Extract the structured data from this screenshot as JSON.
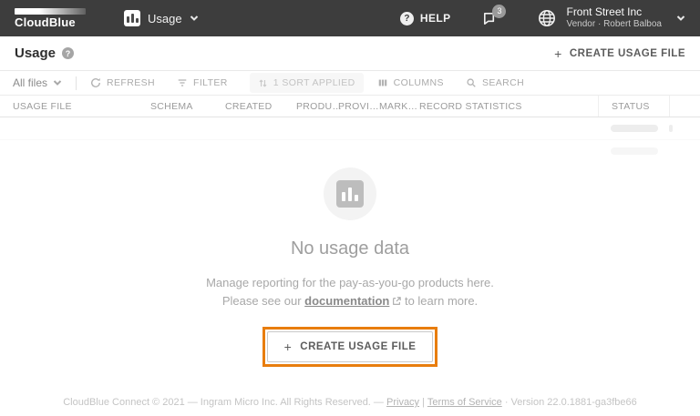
{
  "topbar": {
    "logo": "CloudBlue",
    "module_label": "Usage",
    "help_label": "HELP",
    "notification_count": "3",
    "account_name": "Front Street Inc",
    "account_role": "Vendor · Robert Balboa"
  },
  "page": {
    "title": "Usage",
    "help_glyph": "?",
    "create_label": "CREATE USAGE FILE",
    "plus_glyph": "+"
  },
  "toolbar": {
    "files_filter": "All files",
    "refresh": "REFRESH",
    "filter": "FILTER",
    "sort": "1 SORT APPLIED",
    "columns": "COLUMNS",
    "search": "SEARCH"
  },
  "table": {
    "columns": [
      "USAGE FILE",
      "SCHEMA",
      "CREATED",
      "PRODU…",
      "PROVI…",
      "MARK…",
      "RECORD STATISTICS",
      "STATUS"
    ]
  },
  "empty_state": {
    "title": "No usage data",
    "line1": "Manage reporting for the pay-as-you-go products here.",
    "line2_prefix": "Please see our",
    "link_label": "documentation",
    "line2_suffix": "to learn more.",
    "button_label": "CREATE USAGE FILE",
    "plus_glyph": "+"
  },
  "footer": {
    "prefix": "CloudBlue Connect © 2021 — Ingram Micro Inc. All Rights Reserved. —",
    "privacy": "Privacy",
    "separator": "|",
    "terms": "Terms of Service",
    "version": "· Version 22.0.1881-ga3fbe66"
  },
  "colors": {
    "topbar_bg": "#3d3d3d",
    "highlight_orange": "#e87d0e",
    "skeleton_gray": "#ededed"
  }
}
